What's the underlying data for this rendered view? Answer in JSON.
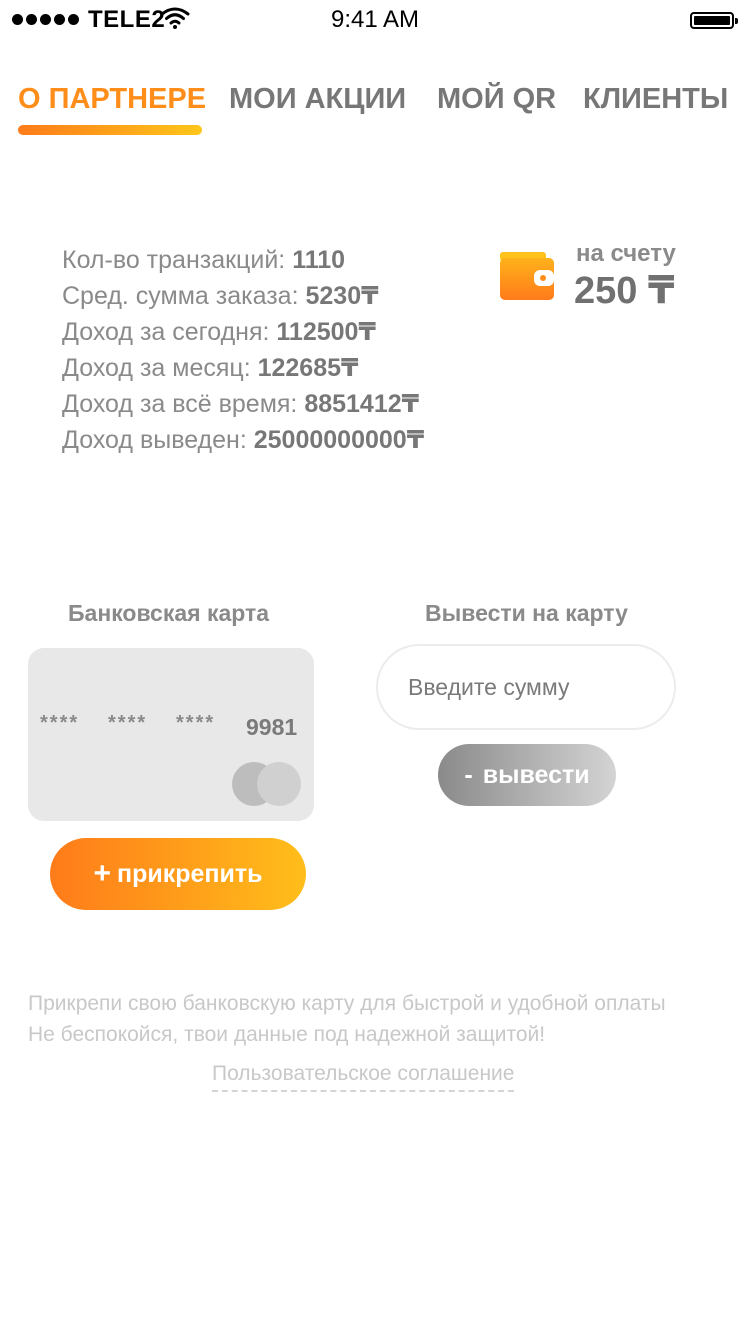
{
  "status_bar": {
    "carrier": "TELE2",
    "time": "9:41 AM"
  },
  "tabs": [
    {
      "label": "О ПАРТНЕРЕ",
      "active": true
    },
    {
      "label": "МОИ АКЦИИ",
      "active": false
    },
    {
      "label": "МОЙ QR",
      "active": false
    },
    {
      "label": "КЛИЕНТЫ",
      "active": false
    }
  ],
  "stats": [
    {
      "label": "Кол-во транзакций: ",
      "value": "1110"
    },
    {
      "label": "Сред. сумма заказа: ",
      "value": "5230₸"
    },
    {
      "label": "Доход за сегодня: ",
      "value": "112500₸"
    },
    {
      "label": "Доход за месяц: ",
      "value": "122685₸"
    },
    {
      "label": "Доход за всё время: ",
      "value": "8851412₸"
    },
    {
      "label": "Доход выведен: ",
      "value": "25000000000₸"
    }
  ],
  "balance": {
    "label": "на счету",
    "value": "250 ₸",
    "icon": "wallet-icon"
  },
  "bank_card": {
    "title": "Банковская карта",
    "masked_groups": [
      "****",
      "****",
      "****"
    ],
    "last4": "9981",
    "attach_label": "прикрепить",
    "attach_icon": "+"
  },
  "withdraw": {
    "title": "Вывести на карту",
    "input_placeholder": "Введите сумму",
    "input_value": "",
    "button_icon": "-",
    "button_label": "вывести"
  },
  "footer": {
    "note_line1": "Прикрепи свою банковскую карту для быстрой и удобной оплаты",
    "note_line2": "Не беспокойся, твои данные под надежной защитой!",
    "agreement_link": "Пользовательское соглашение"
  },
  "colors": {
    "accent_start": "#ff7b1a",
    "accent_end": "#ffc61a",
    "text_gray": "#8a8a8a",
    "card_bg": "#e8e8e8"
  }
}
